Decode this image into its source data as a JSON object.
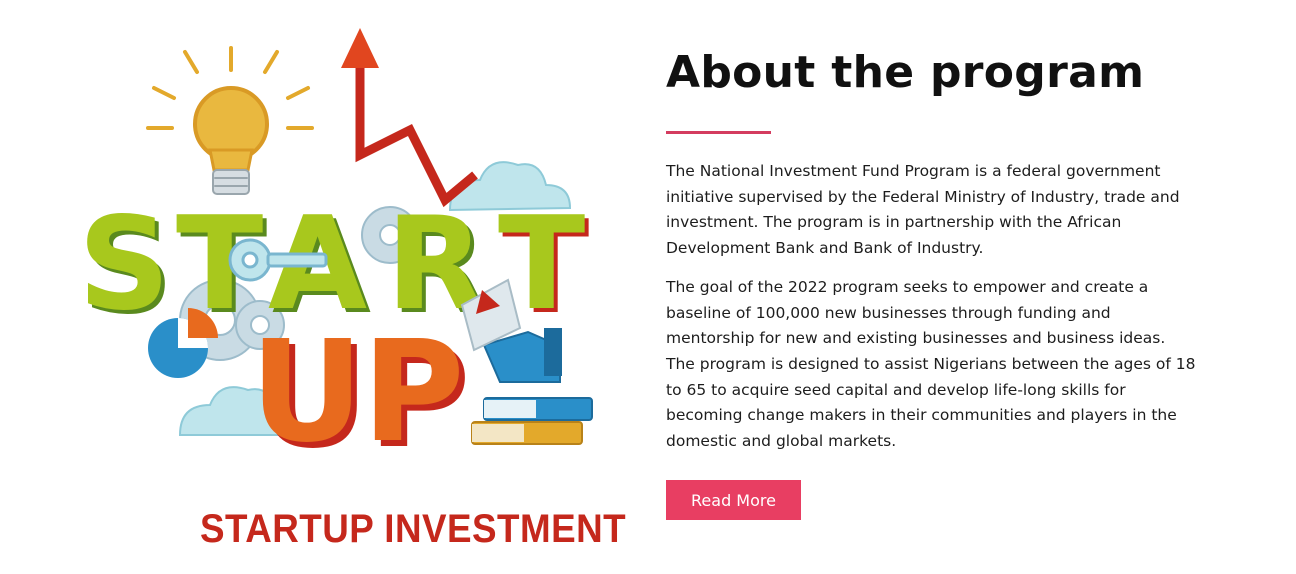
{
  "illustration": {
    "start_letters": [
      "S",
      "T",
      "A",
      "R",
      "T"
    ],
    "up_letters": [
      "U",
      "P"
    ],
    "caption": "STARTUP INVESTMENT",
    "colors": {
      "green": "#a8c81d",
      "dark_green": "#5a8a1e",
      "red": "#c5281c",
      "orange": "#e86a1e",
      "gold": "#e3a92b",
      "blue": "#2a8fc9",
      "light_blue": "#bfe5ec"
    }
  },
  "about": {
    "title": "About the program",
    "paragraphs": [
      "The National Investment Fund Program is a federal government initiative supervised by the Federal Ministry of Industry, trade and investment. The program is in partnership with the African Development Bank and Bank of Industry.",
      "The goal of the 2022 program seeks to empower and create a baseline of 100,000 new businesses through funding and mentorship for new and existing businesses and business ideas. The program is designed to assist Nigerians between the ages of 18 to 65 to acquire seed capital and develop life-long skills for becoming change makers in their communities and players in the domestic and global markets."
    ],
    "read_more_label": "Read More",
    "accent_color": "#e83e62"
  }
}
